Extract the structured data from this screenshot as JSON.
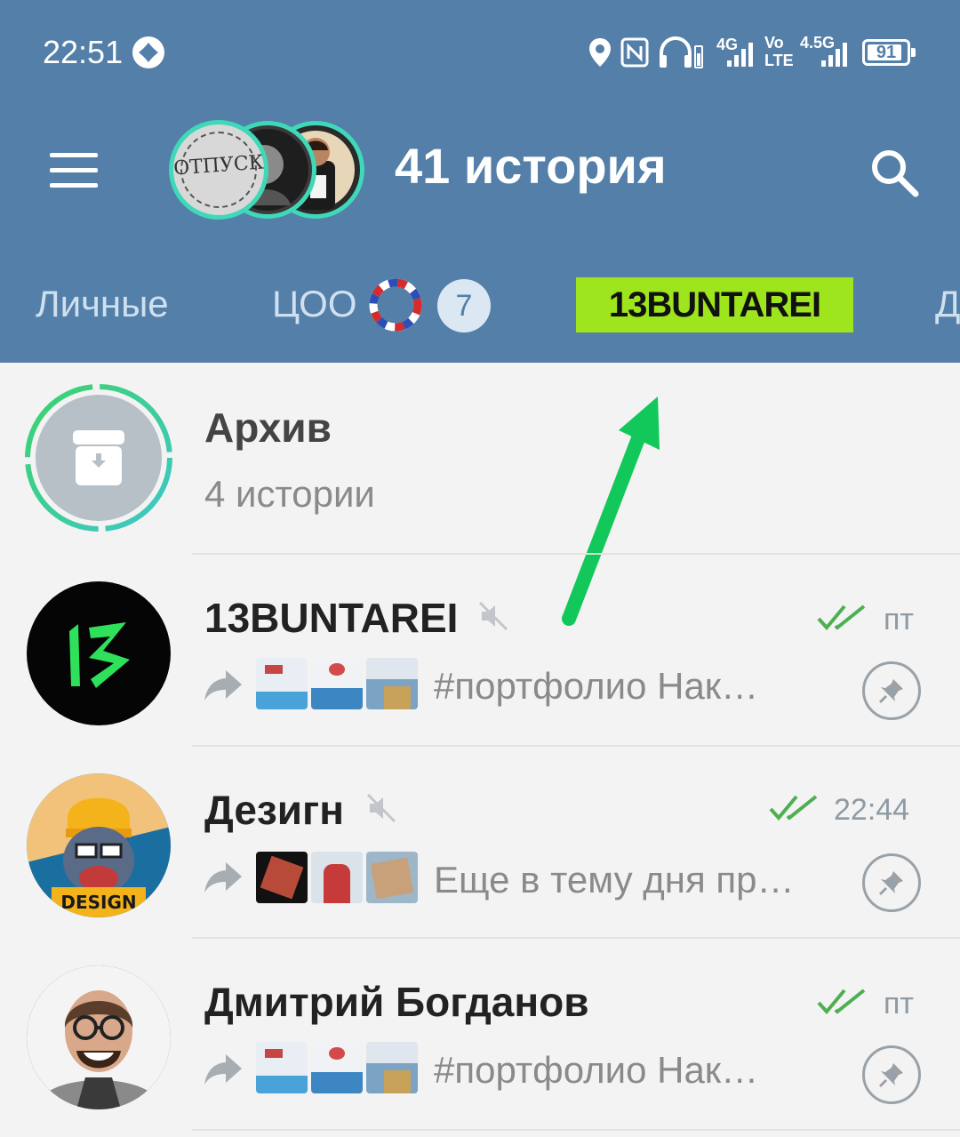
{
  "status_bar": {
    "time": "22:51",
    "app_icon": "clover-icon",
    "net_labels": [
      "4G",
      "Vo",
      "LTE",
      "4.5G"
    ],
    "battery": "91",
    "battery_level": 0.91
  },
  "header": {
    "title": "41 история",
    "stories": [
      {
        "label": "ОТПУСК"
      },
      {
        "label": ""
      },
      {
        "label": ""
      }
    ]
  },
  "tabs": [
    {
      "label": "Личные"
    },
    {
      "label": "ЦОО"
    },
    {
      "label": "13BUNTAREI"
    },
    {
      "label": "Д"
    }
  ],
  "tab_badge": "7",
  "archive": {
    "name": "Архив",
    "subtitle": "4 истории"
  },
  "chats": [
    {
      "name": "13BUNTAREI",
      "time": "пт",
      "preview": "#портфолио  Нак…",
      "avatar_text": "13",
      "muted": true
    },
    {
      "name": "Дезигн",
      "time": "22:44",
      "preview": "Еще в тему дня пр…",
      "avatar_text": "DESIGN",
      "muted": true
    },
    {
      "name": "Дмитрий Богданов",
      "time": "пт",
      "preview": "#портфолио  Нак…",
      "avatar_text": "",
      "muted": false
    }
  ],
  "colors": {
    "header": "#537fa8",
    "accent_green": "#20c653",
    "tab_logo_bg": "#9ee51e",
    "check_green": "#4caf50"
  }
}
